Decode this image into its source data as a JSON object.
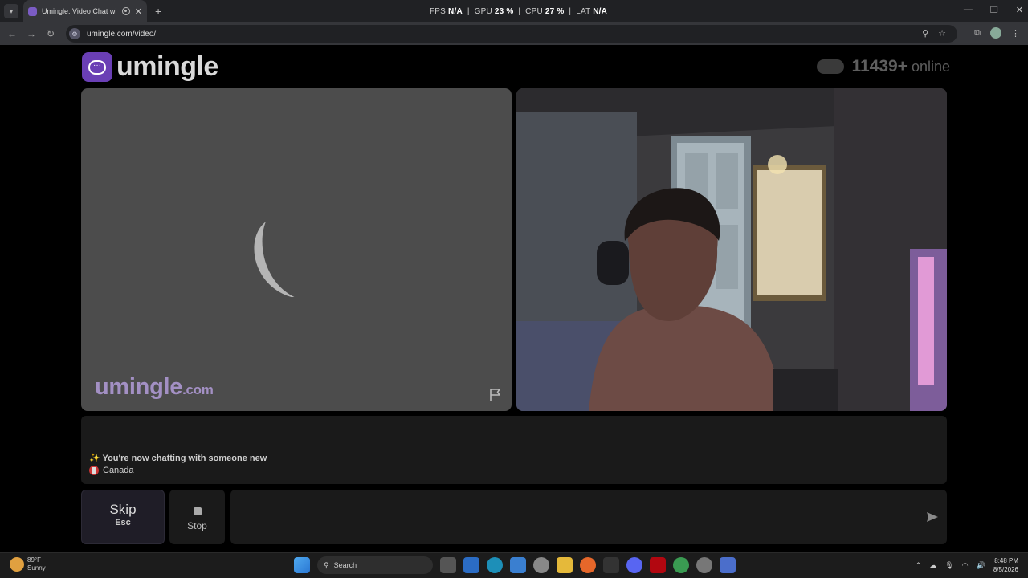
{
  "browser": {
    "tab_title": "Umingle: Video Chat with Strangers",
    "url": "umingle.com/video/",
    "perf": {
      "fps_label": "FPS",
      "fps": "N/A",
      "gpu_label": "GPU",
      "gpu": "23 %",
      "cpu_label": "CPU",
      "cpu": "27 %",
      "lat_label": "LAT",
      "lat": "N/A"
    }
  },
  "site": {
    "logo_text": "umingle",
    "online_count": "11439+",
    "online_label": "online",
    "watermark_main": "umingle",
    "watermark_suffix": ".com"
  },
  "chat": {
    "message": "✨ You're now chatting with someone new",
    "country": "Canada",
    "input_value": ""
  },
  "controls": {
    "skip_label": "Skip",
    "skip_shortcut": "Esc",
    "stop_label": "Stop"
  },
  "taskbar": {
    "weather_temp": "89°F",
    "weather_cond": "Sunny",
    "search_label": "Search",
    "time": "8:48 PM",
    "date": "8/5/2026"
  },
  "colors": {
    "brand": "#6a3fb5",
    "watermark": "#a390c4"
  }
}
